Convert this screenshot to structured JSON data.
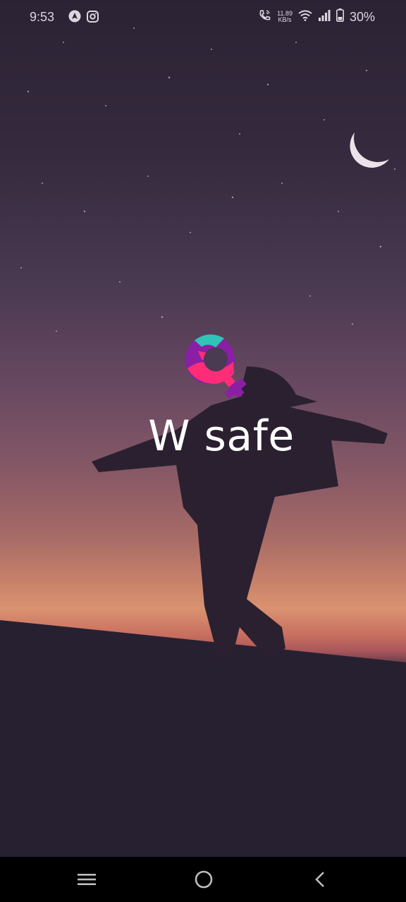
{
  "status_bar": {
    "time": "9:53",
    "left_icons": [
      "nav-arrow-icon",
      "instagram-icon"
    ],
    "network_speed_value": "11.89",
    "network_speed_unit": "KB/s",
    "right_icons": [
      "wifi-call-icon",
      "wifi-icon",
      "signal-icon",
      "battery-icon"
    ],
    "battery_percent": "30%"
  },
  "splash": {
    "app_name": "W safe",
    "logo_icon": "female-symbol-logo"
  },
  "nav_bar": {
    "buttons": [
      "menu-icon",
      "home-circle-icon",
      "back-chevron-icon"
    ]
  },
  "colors": {
    "logo_purple": "#8a1fa6",
    "logo_pink": "#ff2d78",
    "logo_teal": "#2ec4b6",
    "nav_background": "#000000",
    "text": "#ffffff"
  }
}
